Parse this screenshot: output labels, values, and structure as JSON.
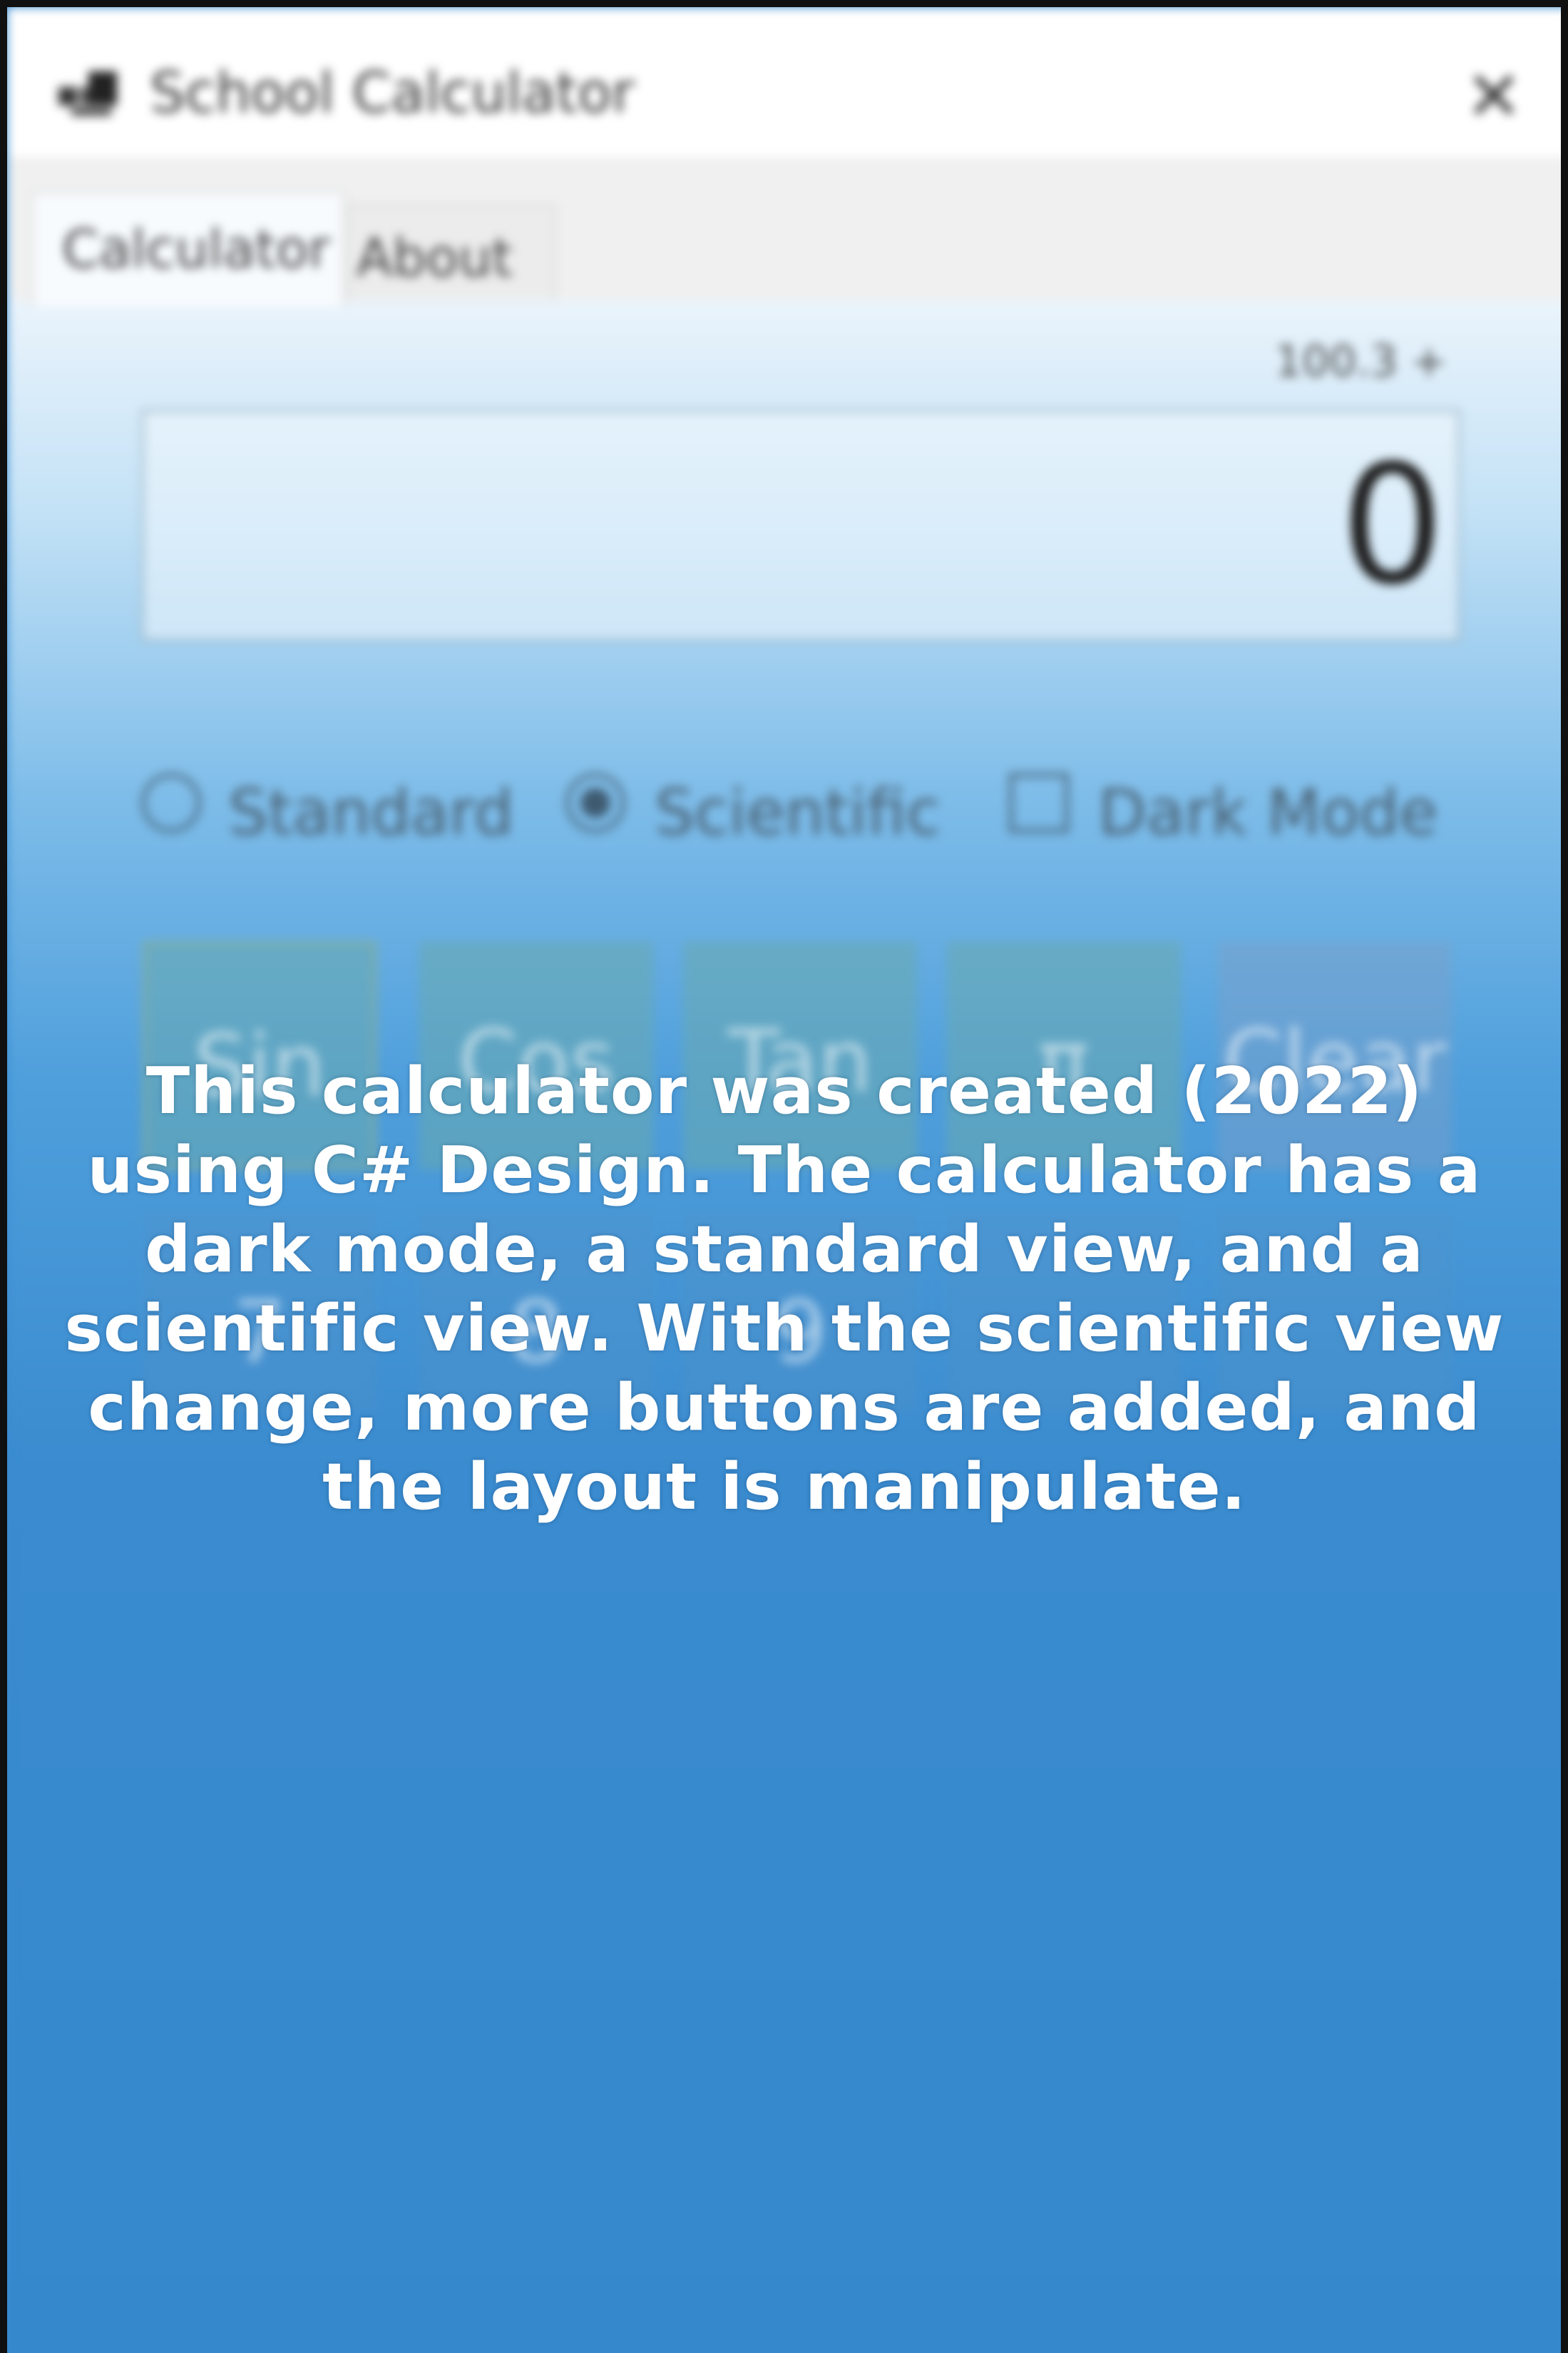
{
  "window": {
    "title": "School Calculator",
    "close_glyph": "✕",
    "app_icon": "calculator-app-icon"
  },
  "tabs": [
    {
      "label": "Calculator",
      "selected": true
    },
    {
      "label": "About",
      "selected": false
    }
  ],
  "display": {
    "history": "100.3 +",
    "value": "0"
  },
  "modes": {
    "standard_label": "Standard",
    "standard_selected": false,
    "scientific_label": "Scientific",
    "scientific_selected": true,
    "dark_mode_label": "Dark Mode",
    "dark_mode_checked": false
  },
  "buttons": {
    "row1": [
      "Sin",
      "Cos",
      "Tan",
      "π",
      "Clear"
    ],
    "row2": [
      "7",
      "8",
      "9",
      "",
      ""
    ]
  },
  "caption": "This calculator was created (2022) using C# Design. The calculator has a dark mode, a standard view, and a scientific view. With the scientific view change, more buttons are added, and the layout is manipulate.",
  "colors": {
    "background_top": "#ffffff",
    "background_bottom": "#3588cc",
    "caption_text": "#ffffff"
  }
}
